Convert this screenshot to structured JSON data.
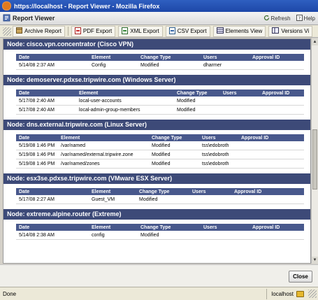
{
  "window": {
    "title": "https://localhost - Report Viewer - Mozilla Firefox"
  },
  "app": {
    "title": "Report Viewer",
    "refresh_label": "Refresh",
    "help_label": "Help"
  },
  "toolbar": {
    "archive_label": "Archive Report",
    "pdf_label": "PDF Export",
    "xml_label": "XML Export",
    "csv_label": "CSV Export",
    "elements_label": "Elements View",
    "versions_label": "Versions Vi"
  },
  "nodes": [
    {
      "title": "Node: cisco.vpn.concentrator (Cisco VPN)",
      "columns": [
        "Date",
        "Element",
        "Change Type",
        "Users",
        "Approval ID"
      ],
      "widths": [
        104,
        70,
        90,
        70,
        78
      ],
      "rows": [
        [
          "5/14/08 2:37 AM",
          "Config",
          "Modified",
          "dharmer",
          ""
        ]
      ]
    },
    {
      "title": "Node: demoserver.pdxse.tripwire.com (Windows Server)",
      "columns": [
        "Date",
        "Element",
        "Change Type",
        "Users",
        "Approval ID"
      ],
      "widths": [
        86,
        140,
        66,
        56,
        64
      ],
      "rows": [
        [
          "5/17/08 2:40 AM",
          "local-user-accounts",
          "Modified",
          "",
          ""
        ],
        [
          "5/17/08 2:40 AM",
          "local-admin-group-members",
          "Modified",
          "",
          ""
        ]
      ]
    },
    {
      "title": "Node: dns.external.tripwire.com (Linux Server)",
      "columns": [
        "Date",
        "Element",
        "Change Type",
        "Users",
        "Approval ID"
      ],
      "widths": [
        60,
        130,
        72,
        56,
        94
      ],
      "rows": [
        [
          "5/19/08 1:46 PM",
          "/var/named",
          "Modified",
          "tss\\edobroth",
          ""
        ],
        [
          "5/19/08 1:46 PM",
          "/var/named/external.tripwire.zone",
          "Modified",
          "tss\\edobroth",
          ""
        ],
        [
          "5/19/08 1:46 PM",
          "/var/named/zones",
          "Modified",
          "tss\\edobroth",
          ""
        ]
      ]
    },
    {
      "title": "Node: esx3se.pdxse.tripwire.com (VMware ESX Server)",
      "columns": [
        "Date",
        "Element",
        "Change Type",
        "Users",
        "Approval ID"
      ],
      "widths": [
        104,
        68,
        76,
        60,
        104
      ],
      "rows": [
        [
          "5/17/08 2:27 AM",
          "Guest_VM",
          "Modified",
          "",
          ""
        ]
      ]
    },
    {
      "title": "Node: extreme.alpine.router (Extreme)",
      "columns": [
        "Date",
        "Element",
        "Change Type",
        "Users",
        "Approval ID"
      ],
      "widths": [
        104,
        70,
        90,
        70,
        78
      ],
      "rows": [
        [
          "5/14/08 2:38 AM",
          "config",
          "Modified",
          "",
          ""
        ]
      ]
    }
  ],
  "footer": {
    "close_label": "Close"
  },
  "status": {
    "text": "Done",
    "host": "localhost"
  }
}
